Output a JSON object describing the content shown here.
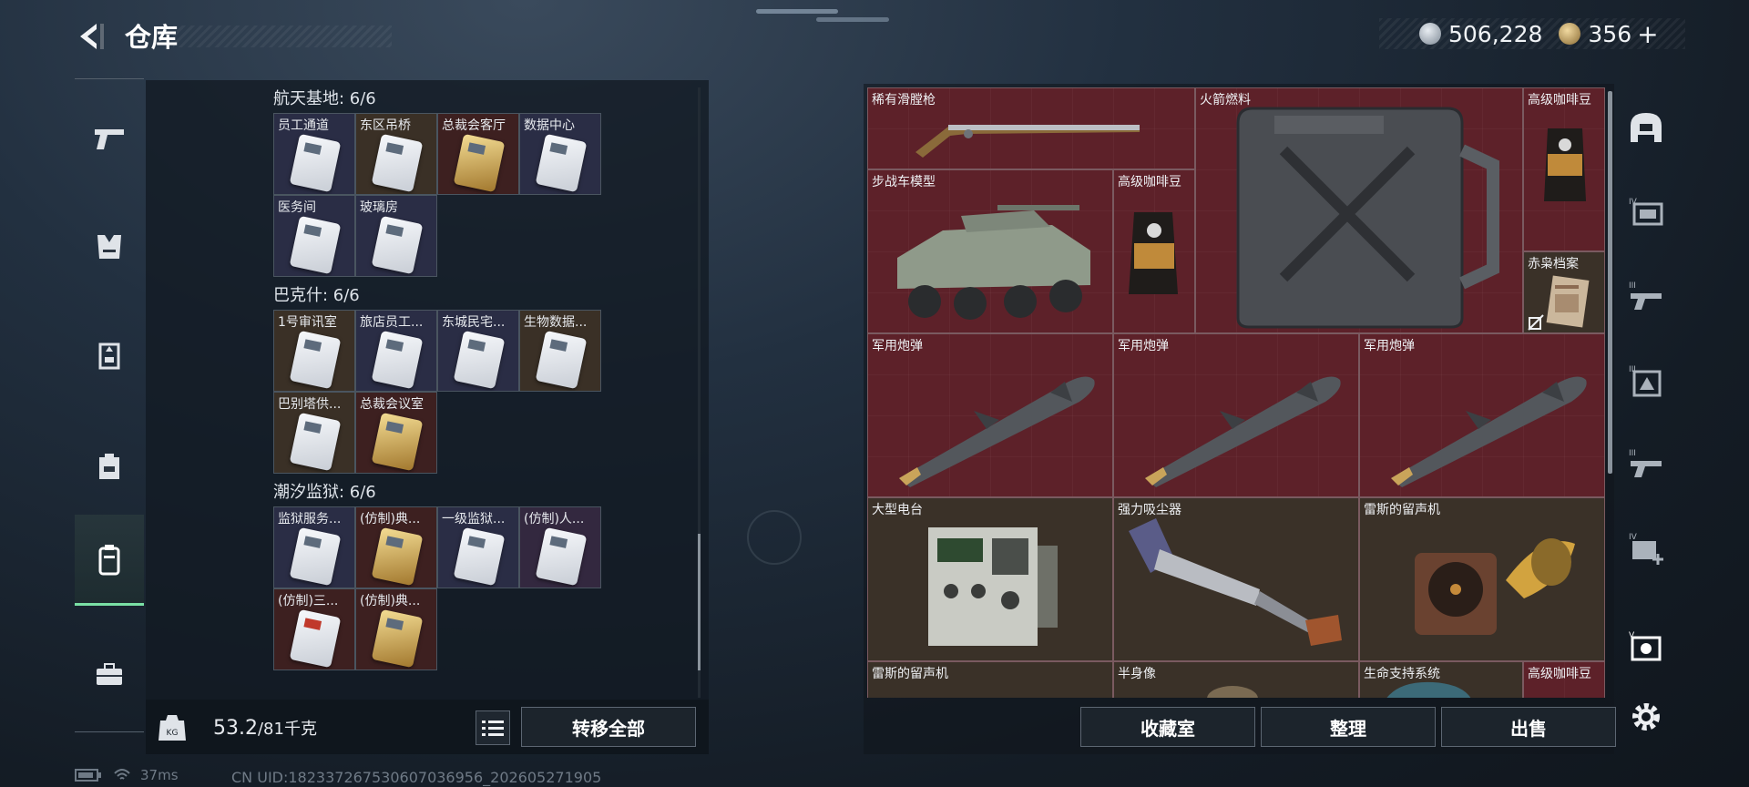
{
  "header": {
    "title": "仓库",
    "currency1": "506,228",
    "currency2": "356",
    "plus": "+"
  },
  "left": {
    "groups": [
      {
        "label": "航天基地: 6/6",
        "cards": [
          {
            "name": "员工通道",
            "tone": "bl",
            "key": "white"
          },
          {
            "name": "东区吊桥",
            "tone": "br",
            "key": "white"
          },
          {
            "name": "总裁会客厅",
            "tone": "rd",
            "key": "gold"
          },
          {
            "name": "数据中心",
            "tone": "bl",
            "key": "white"
          },
          {
            "name": "医务间",
            "tone": "bl",
            "key": "white"
          },
          {
            "name": "玻璃房",
            "tone": "bl",
            "key": "white"
          }
        ]
      },
      {
        "label": "巴克什: 6/6",
        "cards": [
          {
            "name": "1号审讯室",
            "tone": "br",
            "key": "white"
          },
          {
            "name": "旅店员工...",
            "tone": "bl",
            "key": "white"
          },
          {
            "name": "东城民宅...",
            "tone": "bl",
            "key": "white"
          },
          {
            "name": "生物数据...",
            "tone": "br",
            "key": "white"
          },
          {
            "name": "巴别塔供...",
            "tone": "br",
            "key": "white"
          },
          {
            "name": "总裁会议室",
            "tone": "rd",
            "key": "gold"
          }
        ]
      },
      {
        "label": "潮汐监狱: 6/6",
        "cards": [
          {
            "name": "监狱服务...",
            "tone": "bl",
            "key": "white"
          },
          {
            "name": "(仿制)典...",
            "tone": "rd",
            "key": "gold"
          },
          {
            "name": "一级监狱...",
            "tone": "bl",
            "key": "white"
          },
          {
            "name": "(仿制)人...",
            "tone": "pu",
            "key": "white"
          },
          {
            "name": "(仿制)三...",
            "tone": "rd",
            "key": "red"
          },
          {
            "name": "(仿制)典...",
            "tone": "rd",
            "key": "gold"
          }
        ]
      }
    ],
    "weight": {
      "current": "53.2",
      "max": "/81",
      "unit": "千克"
    },
    "transfer_label": "转移全部"
  },
  "right": {
    "items": [
      "稀有滑膛枪",
      "火箭燃料",
      "高级咖啡豆",
      "步战车模型",
      "高级咖啡豆",
      "赤枭档案",
      "军用炮弹",
      "军用炮弹",
      "军用炮弹",
      "大型电台",
      "强力吸尘器",
      "雷斯的留声机",
      "雷斯的留声机",
      "半身像",
      "生命支持系统",
      "高级咖啡豆"
    ],
    "buttons": {
      "collection": "收藏室",
      "sort": "整理",
      "sell": "出售"
    }
  },
  "status": {
    "ping": "37ms",
    "uid": "CN UID:182337267530607036956_202605271905"
  },
  "icons": [
    "back-arrow-icon",
    "silver-coin-icon",
    "gold-coin-icon",
    "pistol-icon",
    "armor-vest-icon",
    "chest-rig-icon",
    "backpack-icon",
    "container-icon",
    "briefcase-icon",
    "kg-weight-icon",
    "list-icon",
    "helmet-icon",
    "settings-gear-icon"
  ]
}
